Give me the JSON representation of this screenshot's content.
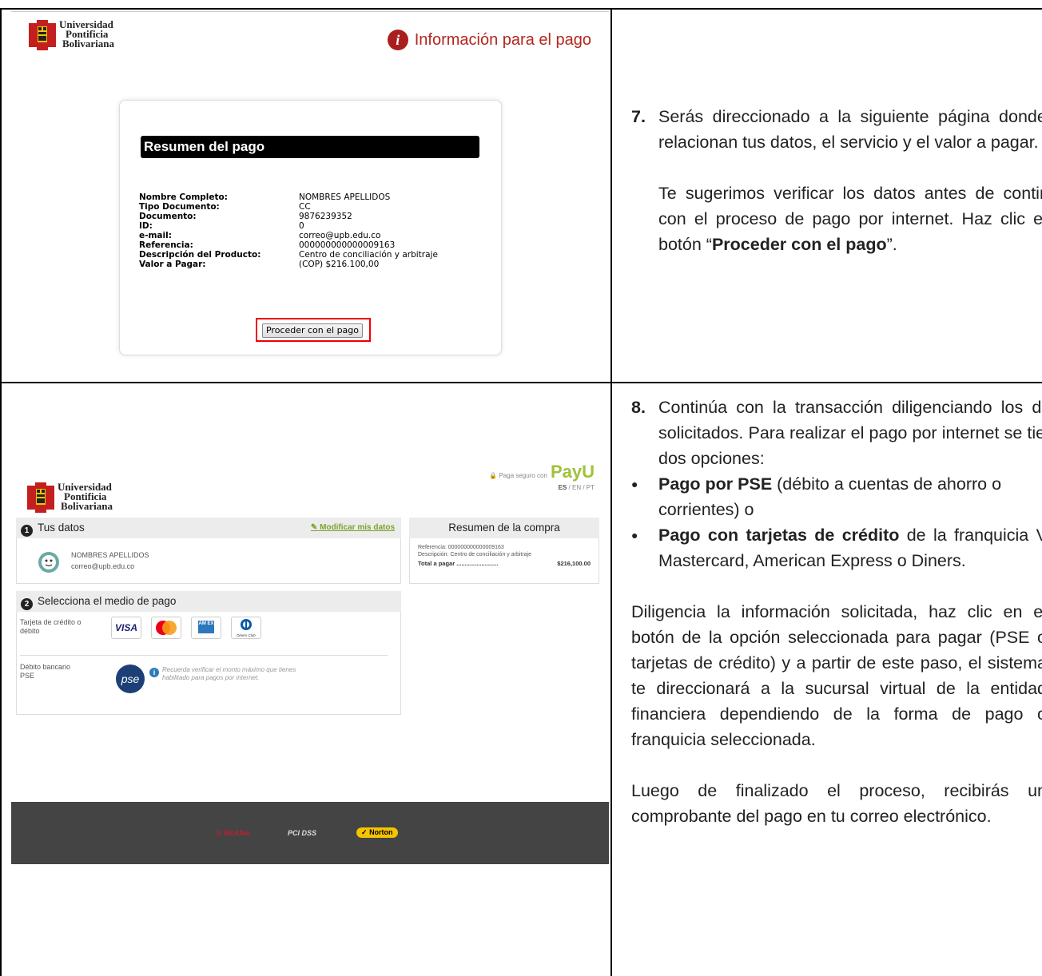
{
  "right_col": {
    "step7_num": "7.",
    "step7_p1": "Serás direccionado a la siguiente página donde se relacionan tus datos, el servicio y el valor a pagar.",
    "step7_p2_a": "Te sugerimos verificar los datos antes de continuar con el proceso de pago por internet. Haz clic en el botón “",
    "step7_p2_bold": "Proceder con el pago",
    "step7_p2_c": "”.",
    "step8_num": "8.",
    "step8_intro": "Continúa con la transacción diligenciando los datos solicitados. Para realizar el pago por internet se tienen dos opciones:",
    "bullet1_bold": "Pago por PSE",
    "bullet1_rest": " (débito a cuentas de ahorro o corrientes) o",
    "bullet2_bold": "Pago con tarjetas de crédito",
    "bullet2_rest": " de la franquicia Visa, Mastercard, American Express o Diners.",
    "p_diligencia": "Diligencia la información solicitada, haz clic en el botón de la opción seleccionada para pagar (PSE o tarjetas de crédito) y a partir de este paso, el sistema te direccionará a la sucursal virtual de la entidad financiera dependiendo de la forma de pago o franquicia seleccionada.",
    "p_luego": "Luego de finalizado el proceso, recibirás un comprobante del pago en tu correo electrónico."
  },
  "shot1": {
    "logo_line1": "Universidad",
    "logo_line2": "Pontificia",
    "logo_line3": "Bolivariana",
    "info_title": "Información para el pago",
    "card_title": "Resumen del pago",
    "rows": [
      {
        "k": "Nombre Completo:",
        "v": "NOMBRES APELLIDOS"
      },
      {
        "k": "Tipo Documento:",
        "v": "CC"
      },
      {
        "k": "Documento:",
        "v": "9876239352"
      },
      {
        "k": "ID:",
        "v": "0"
      },
      {
        "k": "e-mail:",
        "v": "correo@upb.edu.co"
      },
      {
        "k": "Referencia:",
        "v": "000000000000009163"
      },
      {
        "k": "Descripción del Producto:",
        "v": "Centro de conciliación y arbitraje"
      },
      {
        "k": "Valor a Pagar:",
        "v": "(COP) $216.100,00"
      }
    ],
    "proceed_button": "Proceder con el pago"
  },
  "shot2": {
    "logo_line1": "Universidad",
    "logo_line2": "Pontificia",
    "logo_line3": "Bolivariana",
    "secure_text": "Paga seguro con",
    "payu_logo": "PayU",
    "lang_es": "ES",
    "lang_rest": " / EN / PT",
    "step1_num": "1",
    "step1_title": "Tus datos",
    "edit_link": "Modificar mis datos",
    "user_name": "NOMBRES APELLIDOS",
    "user_email": "correo@upb.edu.co",
    "summary_title": "Resumen de la compra",
    "summary_ref": "Referencia: 000000000000009163",
    "summary_desc": "Descripción: Centro de conciliación y arbitraje",
    "summary_total_label": "Total a pagar .........................",
    "summary_total_value": "$216,100.00",
    "step2_num": "2",
    "step2_title": "Selecciona el medio de pago",
    "card_method_label": "Tarjeta de crédito o débito",
    "card_brands": {
      "visa": "VISA",
      "amex": "AM EX",
      "diners": "Diners Club"
    },
    "pse_label": "Débito bancario PSE",
    "pse_logo": "pse",
    "pse_note": "Recuerda verificar el monto máximo que tienes habilitado para pagos por internet.",
    "footer_badges": [
      "McAfee",
      "PCI DSS",
      "Norton"
    ]
  },
  "colors": {
    "accent_red": "#b3261e",
    "payu_green": "#9fc23b",
    "footer_gray": "#444444"
  }
}
